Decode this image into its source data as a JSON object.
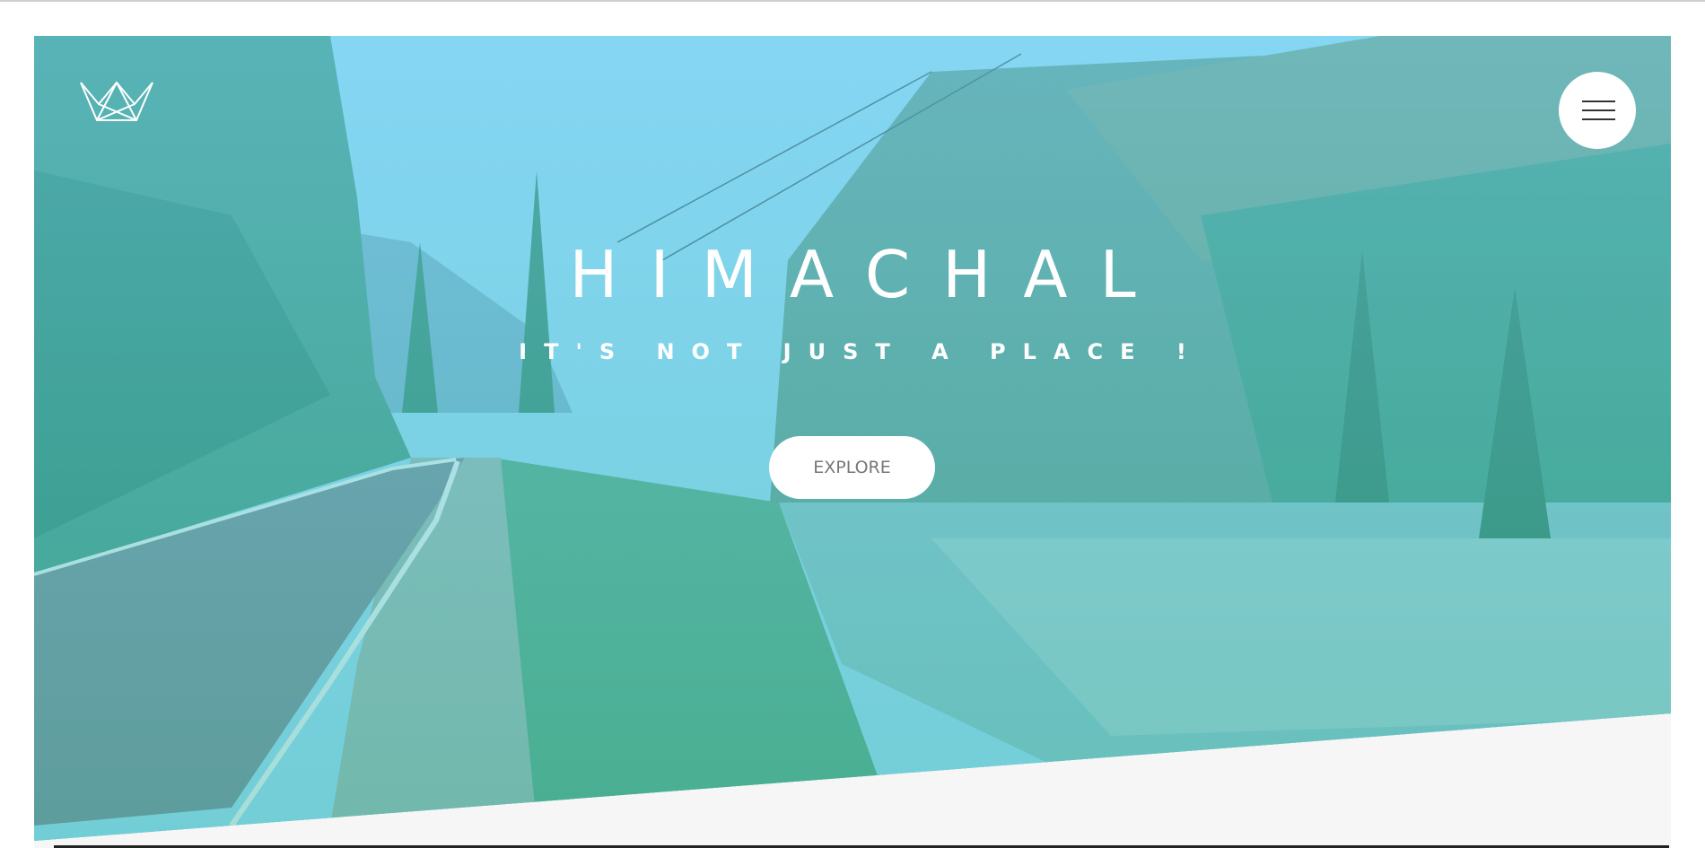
{
  "hero": {
    "title": "HIMACHAL",
    "subtitle": "IT'S NOT JUST A PLACE !",
    "explore_label": "EXPLORE"
  },
  "header": {
    "logo_icon": "crown-icon",
    "menu_icon": "hamburger-menu-icon"
  },
  "colors": {
    "overlay_top": "#7ed5f7",
    "overlay_bottom": "#28b496",
    "background": "#f6f6f6",
    "button_bg": "#ffffff",
    "button_text": "#777777"
  }
}
